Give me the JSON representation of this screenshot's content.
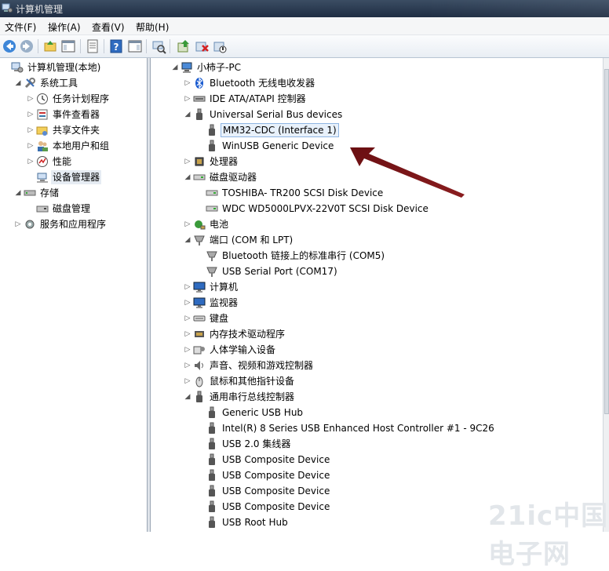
{
  "window": {
    "title": "计算机管理"
  },
  "menu": [
    "文件(F)",
    "操作(A)",
    "查看(V)",
    "帮助(H)"
  ],
  "toolbar_icons": [
    "back-icon",
    "forward-icon",
    "up-folder-icon",
    "console-tree-icon",
    "properties-icon",
    "help-icon",
    "action-pane-icon",
    "scan-hardware-icon",
    "update-driver-icon",
    "uninstall-icon",
    "disable-icon"
  ],
  "left_tree": [
    {
      "label": "计算机管理(本地)",
      "icon": "computer-mgmt-icon",
      "level": 0,
      "expand": "none"
    },
    {
      "label": "系统工具",
      "icon": "tools-icon",
      "level": 1,
      "expand": "open"
    },
    {
      "label": "任务计划程序",
      "icon": "clock-icon",
      "level": 2,
      "expand": "closed"
    },
    {
      "label": "事件查看器",
      "icon": "event-viewer-icon",
      "level": 2,
      "expand": "closed"
    },
    {
      "label": "共享文件夹",
      "icon": "shared-folder-icon",
      "level": 2,
      "expand": "closed"
    },
    {
      "label": "本地用户和组",
      "icon": "users-icon",
      "level": 2,
      "expand": "closed"
    },
    {
      "label": "性能",
      "icon": "performance-icon",
      "level": 2,
      "expand": "closed"
    },
    {
      "label": "设备管理器",
      "icon": "device-manager-icon",
      "level": 2,
      "expand": "none",
      "selected": true
    },
    {
      "label": "存储",
      "icon": "storage-icon",
      "level": 1,
      "expand": "open"
    },
    {
      "label": "磁盘管理",
      "icon": "disk-mgmt-icon",
      "level": 2,
      "expand": "none"
    },
    {
      "label": "服务和应用程序",
      "icon": "services-icon",
      "level": 1,
      "expand": "closed"
    }
  ],
  "device_tree": [
    {
      "label": "小柿子-PC",
      "icon": "computer-icon",
      "level": 0,
      "expand": "open"
    },
    {
      "label": "Bluetooth 无线电收发器",
      "icon": "bluetooth-icon",
      "level": 1,
      "expand": "closed"
    },
    {
      "label": "IDE ATA/ATAPI 控制器",
      "icon": "ide-controller-icon",
      "level": 1,
      "expand": "closed"
    },
    {
      "label": "Universal Serial Bus devices",
      "icon": "usb-icon",
      "level": 1,
      "expand": "open"
    },
    {
      "label": "MM32-CDC (Interface 1)",
      "icon": "usb-icon",
      "level": 2,
      "expand": "none",
      "selected": true
    },
    {
      "label": "WinUSB Generic Device",
      "icon": "usb-icon",
      "level": 2,
      "expand": "none"
    },
    {
      "label": "处理器",
      "icon": "processor-icon",
      "level": 1,
      "expand": "closed"
    },
    {
      "label": "磁盘驱动器",
      "icon": "disk-drive-icon",
      "level": 1,
      "expand": "open"
    },
    {
      "label": "TOSHIBA- TR200 SCSI Disk Device",
      "icon": "disk-drive-icon",
      "level": 2,
      "expand": "none"
    },
    {
      "label": "WDC WD5000LPVX-22V0T SCSI Disk Device",
      "icon": "disk-drive-icon",
      "level": 2,
      "expand": "none"
    },
    {
      "label": "电池",
      "icon": "battery-icon",
      "level": 1,
      "expand": "closed"
    },
    {
      "label": "端口 (COM 和 LPT)",
      "icon": "port-icon",
      "level": 1,
      "expand": "open"
    },
    {
      "label": "Bluetooth 链接上的标准串行 (COM5)",
      "icon": "port-icon",
      "level": 2,
      "expand": "none"
    },
    {
      "label": "USB Serial Port (COM17)",
      "icon": "port-icon",
      "level": 2,
      "expand": "none"
    },
    {
      "label": "计算机",
      "icon": "monitor-icon",
      "level": 1,
      "expand": "closed"
    },
    {
      "label": "监视器",
      "icon": "monitor-icon",
      "level": 1,
      "expand": "closed"
    },
    {
      "label": "键盘",
      "icon": "keyboard-icon",
      "level": 1,
      "expand": "closed"
    },
    {
      "label": "内存技术驱动程序",
      "icon": "memory-tech-icon",
      "level": 1,
      "expand": "closed"
    },
    {
      "label": "人体学输入设备",
      "icon": "hid-icon",
      "level": 1,
      "expand": "closed"
    },
    {
      "label": "声音、视频和游戏控制器",
      "icon": "sound-icon",
      "level": 1,
      "expand": "closed"
    },
    {
      "label": "鼠标和其他指针设备",
      "icon": "mouse-icon",
      "level": 1,
      "expand": "closed"
    },
    {
      "label": "通用串行总线控制器",
      "icon": "usb-icon",
      "level": 1,
      "expand": "open"
    },
    {
      "label": "Generic USB Hub",
      "icon": "usb-icon",
      "level": 2,
      "expand": "none"
    },
    {
      "label": "Intel(R) 8 Series USB Enhanced Host Controller #1 - 9C26",
      "icon": "usb-icon",
      "level": 2,
      "expand": "none"
    },
    {
      "label": "USB 2.0 集线器",
      "icon": "usb-icon",
      "level": 2,
      "expand": "none"
    },
    {
      "label": "USB Composite Device",
      "icon": "usb-icon",
      "level": 2,
      "expand": "none"
    },
    {
      "label": "USB Composite Device",
      "icon": "usb-icon",
      "level": 2,
      "expand": "none"
    },
    {
      "label": "USB Composite Device",
      "icon": "usb-icon",
      "level": 2,
      "expand": "none"
    },
    {
      "label": "USB Composite Device",
      "icon": "usb-icon",
      "level": 2,
      "expand": "none"
    },
    {
      "label": "USB Root Hub",
      "icon": "usb-icon",
      "level": 2,
      "expand": "none"
    }
  ],
  "watermark": "21ic中国电子网",
  "colors": {
    "arrow": "#7a1416",
    "selection_border": "#8fb5e2",
    "selection_fill": "#e8f1fb"
  }
}
